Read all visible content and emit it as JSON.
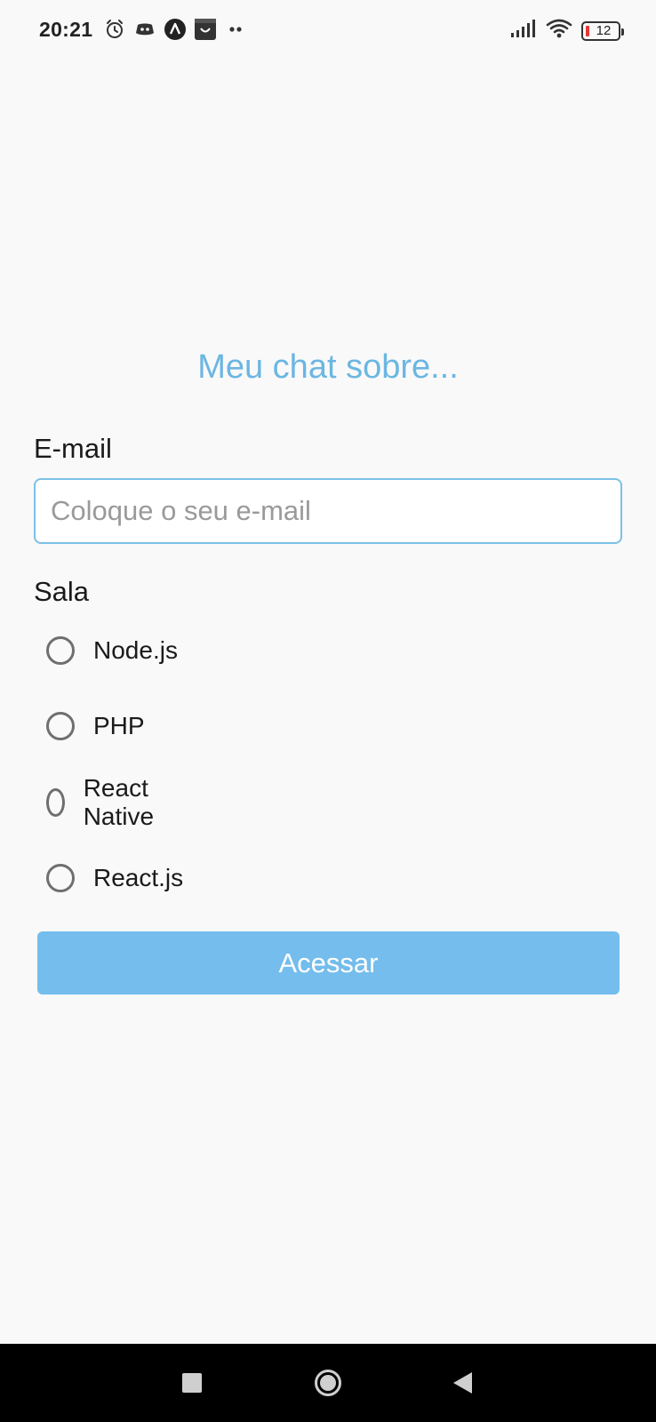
{
  "status_bar": {
    "time": "20:21",
    "battery_level": "12",
    "icons": [
      "alarm-icon",
      "discord-icon",
      "expo-icon",
      "store-icon",
      "more-dots-icon",
      "signal-icon",
      "wifi-icon",
      "battery-icon"
    ],
    "colors": {
      "battery_low": "#e53935"
    }
  },
  "main": {
    "title": "Meu chat sobre...",
    "email": {
      "label": "E-mail",
      "placeholder": "Coloque o seu e-mail",
      "value": ""
    },
    "room": {
      "label": "Sala",
      "options": [
        {
          "label": "Node.js",
          "selected": false
        },
        {
          "label": "PHP",
          "selected": false
        },
        {
          "label": "React Native",
          "selected": false
        },
        {
          "label": "React.js",
          "selected": false
        }
      ]
    },
    "submit_label": "Acessar"
  },
  "colors": {
    "accent": "#6cb6e2",
    "button": "#74bdec",
    "input_border": "#7cc0e6",
    "background": "#f9f9f9"
  },
  "nav_bar": {
    "buttons": [
      "recent-apps-icon",
      "home-icon",
      "back-icon"
    ]
  }
}
